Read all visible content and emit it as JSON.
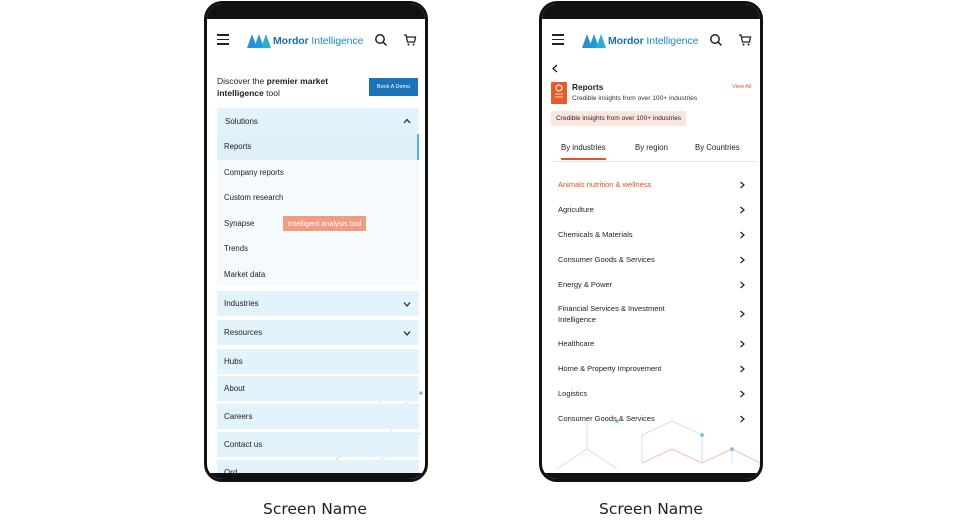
{
  "brand": {
    "name_bold": "Mordor",
    "name_rest": "Intelligence"
  },
  "left_screen": {
    "discover_prefix": "Discover the",
    "discover_bold": "premier market intelligence",
    "discover_suffix": "tool",
    "book_demo_label": "Book A Demo",
    "solutions": {
      "label": "Solutions",
      "items": [
        "Reports",
        "Company reports",
        "Custom research",
        "Synapse",
        "Trends",
        "Market data"
      ],
      "active_item": "Reports",
      "synapse_tooltip": "Intelligent analysis tool"
    },
    "menu": [
      "Industries",
      "Resources",
      "Hubs",
      "About",
      "Careers",
      "Contact us"
    ],
    "menu_truncated": "Ord..."
  },
  "right_screen": {
    "reports_title": "Reports",
    "reports_subtitle": "Credible insights from over 100+ industries",
    "view_all": "View All",
    "badge": "Credible insights from over 100+ industries",
    "tabs": [
      "By industries",
      "By region",
      "By Countries"
    ],
    "selected_tab": "By industries",
    "industries": [
      "Animals nutrition & wellness",
      "Agriculture",
      "Chemicals & Materials",
      "Consumer Goods & Services",
      "Energy & Power",
      "Financial Services & Investment Intelligence",
      "Healthcare",
      "Home & Property Improvement",
      "Logistics",
      "Consumer Goods & Services"
    ]
  },
  "captions": {
    "left": "Screen Name",
    "right": "Screen Name"
  },
  "colors": {
    "brand_blue": "#1b74b8",
    "accent_orange": "#e0562a",
    "panel_bg": "#e3f3fb"
  }
}
